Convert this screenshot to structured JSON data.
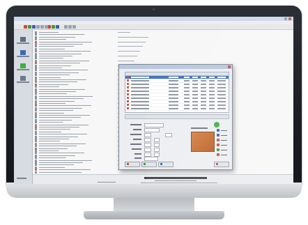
{
  "window": {
    "title": ""
  },
  "menubar": {
    "items": []
  },
  "toolbar": {
    "buttons": [
      {
        "icon": "red-icon",
        "color": "#c84b3c"
      },
      {
        "icon": "green-icon",
        "color": "#3d9a3d"
      },
      {
        "icon": "blue-icon",
        "color": "#3b5fb3"
      },
      {
        "icon": "red-icon",
        "color": "#c84b3c"
      },
      {
        "icon": "green-icon",
        "color": "#3d9a3d"
      },
      {
        "icon": "blue-icon",
        "color": "#3b5fb3"
      }
    ]
  },
  "sidebar": {
    "items": [
      {
        "icon": "monitor-icon",
        "label": "",
        "color": "#5f6c82"
      },
      {
        "icon": "folder-icon",
        "label": "",
        "color": "#3b69b8"
      },
      {
        "icon": "green-leaf-icon",
        "label": "",
        "color": "#3fae3f"
      },
      {
        "icon": "document-icon",
        "label": "",
        "color": "#6b7a8f"
      }
    ]
  },
  "file_list": {
    "rows": []
  },
  "dialog": {
    "title": "",
    "table": {
      "columns": [],
      "rows": []
    },
    "form": {
      "fields": []
    },
    "color_swatch": {
      "label": "",
      "color": "#c96d30"
    },
    "side_buttons": [
      {
        "icon": "blue-icon",
        "label": "",
        "color": "#3b5fb3"
      },
      {
        "icon": "blue-icon",
        "label": "",
        "color": "#3b5fb3"
      },
      {
        "icon": "red-icon",
        "label": "",
        "color": "#c84b3c"
      },
      {
        "icon": "red-icon",
        "label": "",
        "color": "#c84b3c"
      },
      {
        "icon": "green-icon",
        "label": "",
        "color": "#3d9a3d"
      },
      {
        "icon": "red-icon",
        "label": "",
        "color": "#c84b3c"
      }
    ],
    "bottom_buttons": [
      {
        "icon": "red-icon",
        "label": "",
        "color": "#c84b3c"
      },
      {
        "icon": "green-icon",
        "label": "",
        "color": "#3d9a3d"
      },
      {
        "icon": "blue-icon",
        "label": "",
        "color": "#3b5fb3"
      }
    ]
  },
  "footer": {
    "title": "",
    "subtitle": "",
    "copyright": ""
  },
  "status": {
    "left": "",
    "middle": ""
  }
}
